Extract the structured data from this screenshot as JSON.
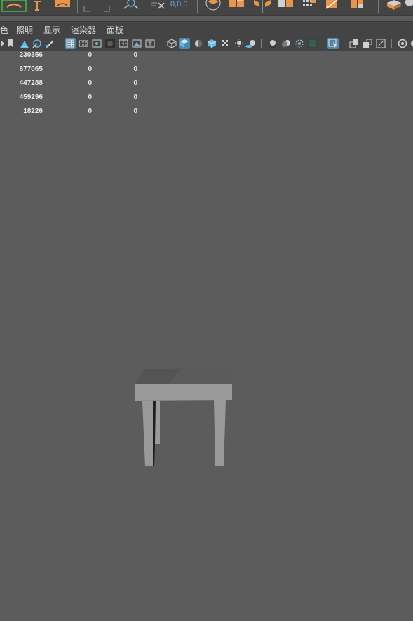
{
  "shelf": {
    "coord_readout": "0,0,0"
  },
  "menubar": {
    "items": [
      {
        "label": "色"
      },
      {
        "label": "照明"
      },
      {
        "label": "显示"
      },
      {
        "label": "渲染器"
      },
      {
        "label": "面板"
      }
    ]
  },
  "hud": {
    "rows": [
      {
        "count": "230356",
        "a": "0",
        "b": "0"
      },
      {
        "count": "677065",
        "a": "0",
        "b": "0"
      },
      {
        "count": "447288",
        "a": "0",
        "b": "0"
      },
      {
        "count": "459296",
        "a": "0",
        "b": "0"
      },
      {
        "count": "18226",
        "a": "0",
        "b": "0"
      }
    ]
  },
  "colors": {
    "viewport_bg": "#5c5c5c",
    "toolbar_bg": "#444444",
    "accent_orange": "#e8954a",
    "accent_blue": "#5fb8e6",
    "active_button": "#5285a6"
  },
  "icons": {
    "shelf": [
      "curve-tool-icon",
      "text-tool-icon",
      "sweep-mesh-icon",
      "grid-snap-icon",
      "target-icon",
      "clear-icon",
      "box-stack-icon",
      "extrude-icon",
      "bevel-icon",
      "bridge-icon",
      "grid-mesh-icon",
      "slice-icon",
      "multi-cut-icon",
      "paint-cube-icon"
    ],
    "panel": [
      "camera-icon",
      "bookmark-icon",
      "lock-camera-icon",
      "paint-icon",
      "draw-icon",
      "grid-icon",
      "film-gate-icon",
      "resolution-gate-icon",
      "gate-mask-icon",
      "field-chart-icon",
      "safe-action-icon",
      "safe-title-icon",
      "wireframe-cube-icon",
      "smooth-shade-cube-icon",
      "default-material-icon",
      "textured-icon",
      "xray-icon",
      "lighting-icon",
      "shadow-icon",
      "ambient-occlusion-icon",
      "motion-blur-icon",
      "anti-alias-icon",
      "depth-of-field-icon",
      "isolate-select-icon",
      "xray-joints-icon",
      "xray-active-icon",
      "backface-icon",
      "exposure-icon"
    ]
  }
}
